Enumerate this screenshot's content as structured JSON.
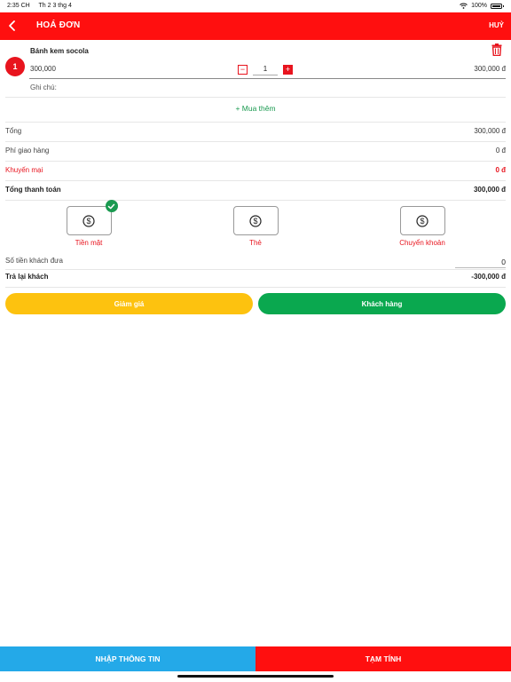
{
  "status_bar": {
    "time": "2:35 CH",
    "date": "Th 2 3 thg 4",
    "battery": "100%"
  },
  "header": {
    "title": "HOÁ ĐƠN",
    "cancel_label": "HUỶ"
  },
  "order_item": {
    "index": "1",
    "name": "Bánh kem socola",
    "unit_price": "300,000",
    "quantity": "1",
    "line_total": "300,000 đ",
    "note_label": "Ghi chú:"
  },
  "add_more_label": "+ Mua thêm",
  "summary": {
    "subtotal_label": "Tổng",
    "subtotal_value": "300,000 đ",
    "shipping_label": "Phí giao hàng",
    "shipping_value": "0 đ",
    "promo_label": "Khuyến mại",
    "promo_value": "0 đ",
    "total_label": "Tổng thanh toán",
    "total_value": "300,000 đ"
  },
  "payment_methods": [
    {
      "label": "Tiền mặt",
      "icon": "dollar-icon",
      "selected": true
    },
    {
      "label": "Thẻ",
      "icon": "dollar-icon",
      "selected": false
    },
    {
      "label": "Chuyển khoản",
      "icon": "dollar-icon",
      "selected": false
    }
  ],
  "cash": {
    "given_label": "Số tiền khách đưa",
    "given_value": "0",
    "change_label": "Trả lại khách",
    "change_value": "-300,000 đ"
  },
  "actions": {
    "discount_label": "Giảm giá",
    "customer_label": "Khách hàng"
  },
  "bottom_bar": {
    "info_label": "NHẬP THÔNG TIN",
    "calc_label": "TẠM TÍNH"
  },
  "colors": {
    "primary_red": "#ff0f0f",
    "green": "#0aa84f",
    "yellow": "#fdc20f",
    "blue": "#24a9e8"
  }
}
